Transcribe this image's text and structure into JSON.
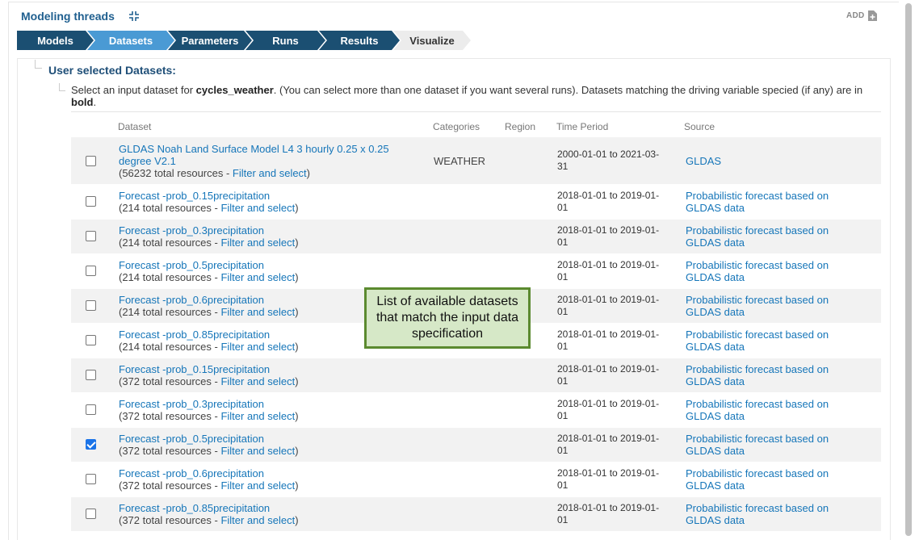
{
  "header": {
    "title": "Modeling threads",
    "add_label": "ADD"
  },
  "steps": [
    {
      "label": "Models",
      "state": "done"
    },
    {
      "label": "Datasets",
      "state": "active"
    },
    {
      "label": "Parameters",
      "state": "done"
    },
    {
      "label": "Runs",
      "state": "done"
    },
    {
      "label": "Results",
      "state": "done"
    },
    {
      "label": "Visualize",
      "state": "todo"
    }
  ],
  "section": {
    "title": "User selected Datasets:",
    "instr_prefix": "Select an input dataset for ",
    "instr_model": "cycles_weather",
    "instr_middle": ". (You can select more than one dataset if you want several runs). Datasets matching the driving variable specied (if any) are in ",
    "instr_bold": "bold",
    "instr_suffix": "."
  },
  "table": {
    "headers": {
      "dataset": "Dataset",
      "categories": "Categories",
      "region": "Region",
      "period": "Time Period",
      "source": "Source"
    },
    "filter_label": "Filter and select",
    "rows": [
      {
        "name": "GLDAS Noah Land Surface Model L4 3 hourly 0.25 x 0.25 degree V2.1",
        "resources": "(56232 total resources - ",
        "close": ")",
        "category": "WEATHER",
        "period": "2000-01-01 to 2021-03-31",
        "source": "GLDAS",
        "checked": false
      },
      {
        "name": "Forecast -prob_0.15precipitation",
        "resources": "(214 total resources - ",
        "close": ")",
        "category": "",
        "period": "2018-01-01 to 2019-01-01",
        "source": "Probabilistic forecast based on GLDAS data",
        "checked": false
      },
      {
        "name": "Forecast -prob_0.3precipitation",
        "resources": "(214 total resources - ",
        "close": ")",
        "category": "",
        "period": "2018-01-01 to 2019-01-01",
        "source": "Probabilistic forecast based on GLDAS data",
        "checked": false
      },
      {
        "name": "Forecast -prob_0.5precipitation",
        "resources": "(214 total resources - ",
        "close": ")",
        "category": "",
        "period": "2018-01-01 to 2019-01-01",
        "source": "Probabilistic forecast based on GLDAS data",
        "checked": false
      },
      {
        "name": "Forecast -prob_0.6precipitation",
        "resources": "(214 total resources - ",
        "close": ")",
        "category": "",
        "period": "2018-01-01 to 2019-01-01",
        "source": "Probabilistic forecast based on GLDAS data",
        "checked": false
      },
      {
        "name": "Forecast -prob_0.85precipitation",
        "resources": "(214 total resources - ",
        "close": ")",
        "category": "",
        "period": "2018-01-01 to 2019-01-01",
        "source": "Probabilistic forecast based on GLDAS data",
        "checked": false
      },
      {
        "name": "Forecast -prob_0.15precipitation",
        "resources": "(372 total resources - ",
        "close": ")",
        "category": "",
        "period": "2018-01-01 to 2019-01-01",
        "source": "Probabilistic forecast based on GLDAS data",
        "checked": false
      },
      {
        "name": "Forecast -prob_0.3precipitation",
        "resources": "(372 total resources - ",
        "close": ")",
        "category": "",
        "period": "2018-01-01 to 2019-01-01",
        "source": "Probabilistic forecast based on GLDAS data",
        "checked": false
      },
      {
        "name": "Forecast -prob_0.5precipitation",
        "resources": "(372 total resources - ",
        "close": ")",
        "category": "",
        "period": "2018-01-01 to 2019-01-01",
        "source": "Probabilistic forecast based on GLDAS data",
        "checked": true
      },
      {
        "name": "Forecast -prob_0.6precipitation",
        "resources": "(372 total resources - ",
        "close": ")",
        "category": "",
        "period": "2018-01-01 to 2019-01-01",
        "source": "Probabilistic forecast based on GLDAS data",
        "checked": false
      },
      {
        "name": "Forecast -prob_0.85precipitation",
        "resources": "(372 total resources - ",
        "close": ")",
        "category": "",
        "period": "2018-01-01 to 2019-01-01",
        "source": "Probabilistic forecast based on GLDAS data",
        "checked": false
      }
    ]
  },
  "annotation": {
    "text": "List of available datasets that match the input data specification"
  },
  "icons": {
    "collapse": "collapse-arrows-icon",
    "add": "add-file-icon"
  },
  "colors": {
    "step_done": "#1b4f72",
    "step_active": "#4a9ad4",
    "link": "#1676b9",
    "annotation_bg": "#d6e8c7",
    "annotation_border": "#5b8a2f"
  }
}
